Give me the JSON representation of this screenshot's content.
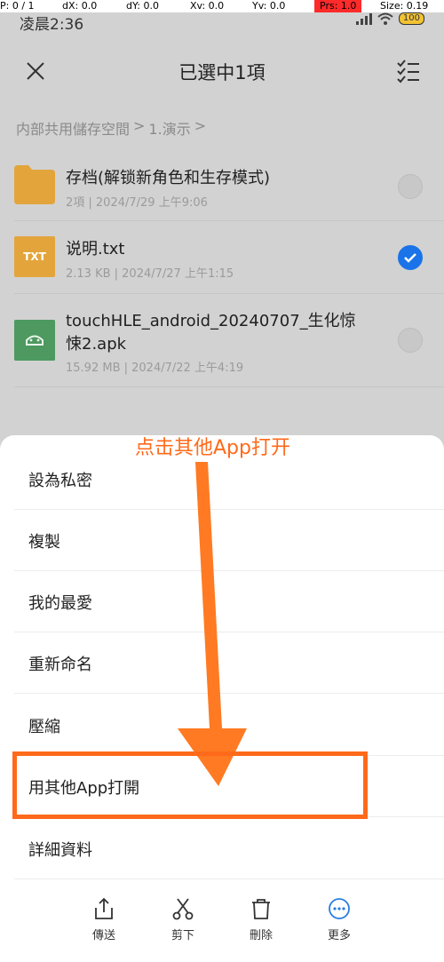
{
  "debug": {
    "p": "P: 0 / 1",
    "dx": "dX: 0.0",
    "dy": "dY: 0.0",
    "xv": "Xv: 0.0",
    "yv": "Yv: 0.0",
    "prs": "Prs: 1.0",
    "size": "Size: 0.19"
  },
  "status": {
    "time": "凌晨2:36",
    "battery": "100"
  },
  "header": {
    "title": "已選中1項"
  },
  "breadcrumb": {
    "root": "内部共用儲存空間",
    "sep1": ">",
    "folder": "1.演示",
    "sep2": ">"
  },
  "files": [
    {
      "name": "存档(解锁新角色和生存模式)",
      "meta": "2項 | 2024/7/29 上午9:06",
      "checked": false
    },
    {
      "name": "说明.txt",
      "meta": "2.13 KB | 2024/7/27 上午1:15",
      "icon_text": "TXT",
      "checked": true
    },
    {
      "name_line1": "touchHLE_android_20240707_生化惊",
      "name_line2": "悚2.apk",
      "meta": "15.92 MB | 2024/7/22 上午4:19",
      "checked": false
    }
  ],
  "annotation": {
    "text": "点击其他App打开"
  },
  "menu": [
    {
      "label": "設為私密"
    },
    {
      "label": "複製"
    },
    {
      "label": "我的最愛"
    },
    {
      "label": "重新命名"
    },
    {
      "label": "壓縮"
    },
    {
      "label": "用其他App打開"
    },
    {
      "label": "詳細資料"
    }
  ],
  "toolbar": [
    {
      "label": "傳送",
      "icon": "share-icon"
    },
    {
      "label": "剪下",
      "icon": "scissors-icon"
    },
    {
      "label": "刪除",
      "icon": "trash-icon"
    },
    {
      "label": "更多",
      "icon": "more-icon"
    }
  ],
  "colors": {
    "accent": "#ff6a1a",
    "check": "#1a73e8",
    "more_icon": "#2a7de1"
  }
}
